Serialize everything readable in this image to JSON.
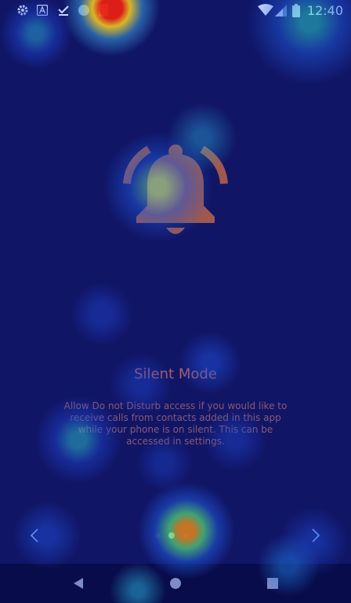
{
  "status_bar": {
    "time": "12:40",
    "icons": [
      "settings-icon",
      "app-a-icon",
      "download-done-icon",
      "circle-icon",
      "sd-card-icon",
      "wifi-icon",
      "signal-icon",
      "battery-icon"
    ]
  },
  "onboarding": {
    "illustration": "bell-ringing-icon",
    "title": "Silent Mode",
    "description": "Allow Do not Disturb access if you would like to receive calls from contacts added in this app while your phone is on silent. This can be accessed in settings.",
    "page_count": 3,
    "current_page": 2
  },
  "pager": {
    "prev_icon": "chevron-left-icon",
    "next_icon": "chevron-right-icon"
  },
  "nav_bar": {
    "back_icon": "back-triangle-icon",
    "home_icon": "home-circle-icon",
    "recents_icon": "recents-square-icon"
  },
  "colors": {
    "background": "#111566",
    "bell": "#a0584e",
    "title": "#a8606a",
    "active_dot": "#d8ffe8"
  }
}
